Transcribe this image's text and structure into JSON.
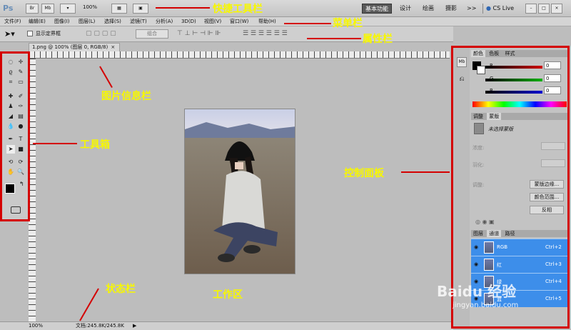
{
  "appbar": {
    "logo": "Ps",
    "br_label": "Br",
    "mb_label": "Mb",
    "zoom": "100%",
    "workspaces": [
      "基本功能",
      "设计",
      "绘画",
      "摄影"
    ],
    "more": ">>",
    "cs_live": "CS Live"
  },
  "menus": [
    "文件(F)",
    "编辑(E)",
    "图像(I)",
    "图层(L)",
    "选择(S)",
    "滤镜(T)",
    "分析(A)",
    "3D(D)",
    "视图(V)",
    "窗口(W)",
    "帮助(H)"
  ],
  "options": {
    "auto_select": "显示定界框",
    "combine": "组合"
  },
  "document": {
    "tab_title": "1.png @ 100% (图层 0, RGB/8)",
    "tab_close": "×"
  },
  "status": {
    "zoom": "100%",
    "doc_info": "文档:245.8K/245.8K"
  },
  "color_panel": {
    "tabs": [
      "颜色",
      "色板",
      "样式"
    ],
    "channels": [
      {
        "label": "R",
        "value": "0"
      },
      {
        "label": "G",
        "value": "0"
      },
      {
        "label": "B",
        "value": "0"
      }
    ]
  },
  "adjust_panel": {
    "tabs": [
      "调整",
      "蒙版"
    ],
    "mask_title": "未选择蒙版",
    "density_label": "浓度:",
    "feather_label": "羽化:",
    "refine_label": "调整:",
    "buttons": [
      "蒙版边缘...",
      "颜色范围...",
      "反相"
    ]
  },
  "layers_panel": {
    "tabs": [
      "图层",
      "通道",
      "路径"
    ],
    "channels": [
      {
        "name": "RGB",
        "shortcut": "Ctrl+2"
      },
      {
        "name": "红",
        "shortcut": "Ctrl+3"
      },
      {
        "name": "绿",
        "shortcut": "Ctrl+4"
      },
      {
        "name": "蓝",
        "shortcut": "Ctrl+5"
      }
    ]
  },
  "annotations": {
    "quick_toolbar": "快捷工具栏",
    "menu_bar": "菜单栏",
    "options_bar": "属性栏",
    "image_info_bar": "图片信息栏",
    "toolbox": "工具箱",
    "control_panel": "控制面板",
    "status_bar": "状态栏",
    "workspace": "工作区"
  },
  "watermark": {
    "brand": "Baidu 经验",
    "url": "jingyan.baidu.com"
  },
  "colors": {
    "annotation_text": "#f7f700",
    "annotation_arrow": "#d40000",
    "channel_selected": "#3d8eea"
  }
}
